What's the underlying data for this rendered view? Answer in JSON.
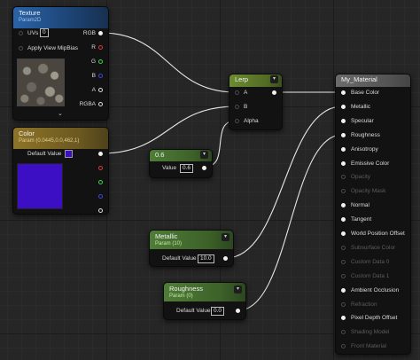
{
  "nodes": {
    "texture": {
      "title": "Texture",
      "subtitle": "Param2D",
      "inputs": [
        "UVs",
        "Apply View MipBias"
      ],
      "uvs_value": "0",
      "outputs": [
        "RGB",
        "R",
        "G",
        "B",
        "A",
        "RGBA"
      ]
    },
    "color": {
      "title": "Color",
      "subtitle": "Param (0.0445,0.0,462,1)",
      "default_label": "Default Value",
      "swatch_color": "#3d0fc4"
    },
    "lerp": {
      "title": "Lerp",
      "inputs": [
        "A",
        "B",
        "Alpha"
      ]
    },
    "constant": {
      "title": "0.6",
      "value_label": "Value",
      "value": "0.6"
    },
    "metallic": {
      "title": "Metallic",
      "subtitle": "Param (10)",
      "default_label": "Default Value",
      "value": "10.0"
    },
    "roughness": {
      "title": "Roughness",
      "subtitle": "Param (0)",
      "default_label": "Default Value",
      "value": "0.0"
    },
    "material": {
      "title": "My_Material",
      "pins": [
        {
          "label": "Base Color",
          "enabled": true
        },
        {
          "label": "Metallic",
          "enabled": true
        },
        {
          "label": "Specular",
          "enabled": true
        },
        {
          "label": "Roughness",
          "enabled": true
        },
        {
          "label": "Anisotropy",
          "enabled": true
        },
        {
          "label": "Emissive Color",
          "enabled": true
        },
        {
          "label": "Opacity",
          "enabled": false
        },
        {
          "label": "Opacity Mask",
          "enabled": false
        },
        {
          "label": "Normal",
          "enabled": true
        },
        {
          "label": "Tangent",
          "enabled": true
        },
        {
          "label": "World Position Offset",
          "enabled": true
        },
        {
          "label": "Subsurface Color",
          "enabled": false
        },
        {
          "label": "Custom Data 0",
          "enabled": false
        },
        {
          "label": "Custom Data 1",
          "enabled": false
        },
        {
          "label": "Ambient Occlusion",
          "enabled": true
        },
        {
          "label": "Refraction",
          "enabled": false
        },
        {
          "label": "Pixel Depth Offset",
          "enabled": true
        },
        {
          "label": "Shading Model",
          "enabled": false
        },
        {
          "label": "Front Material",
          "enabled": false
        }
      ]
    }
  },
  "colors": {
    "pin_red": "#d83a3a",
    "pin_green": "#3ad84a",
    "pin_blue": "#3a4ad8",
    "wire": "#e6e6e6"
  }
}
